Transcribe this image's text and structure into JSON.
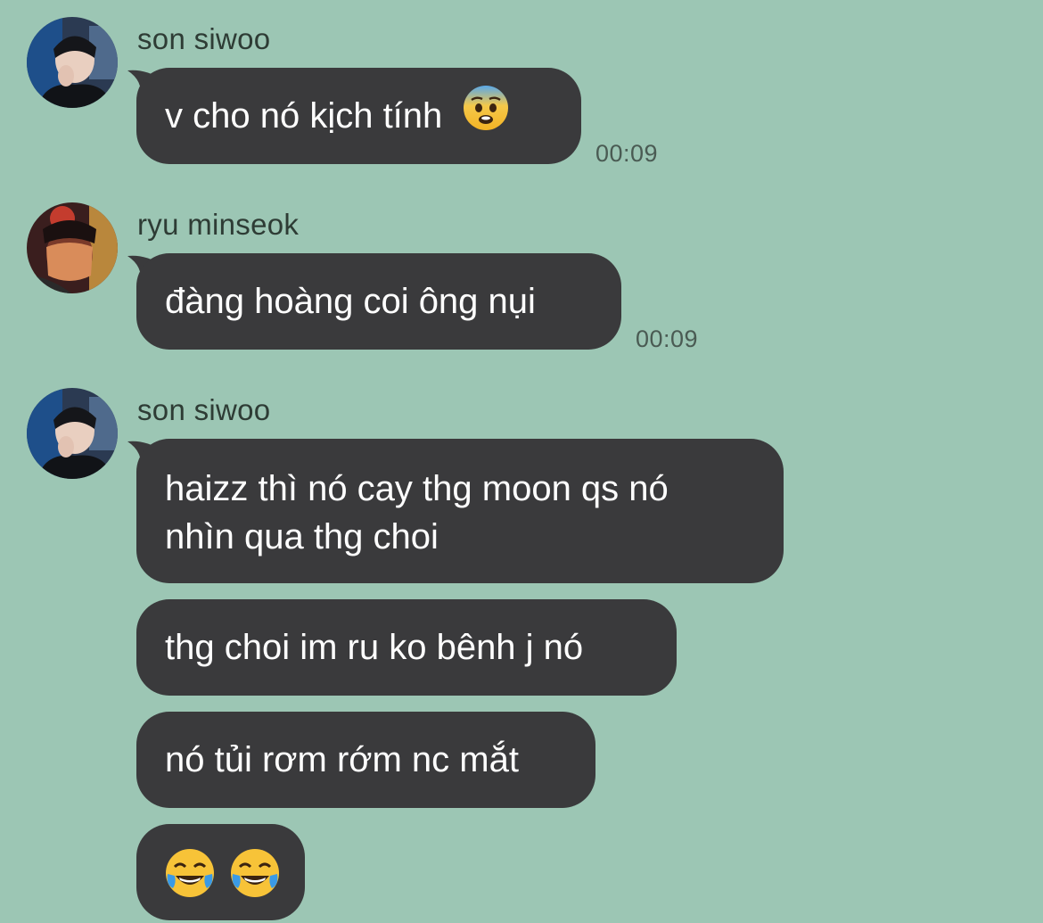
{
  "messages": [
    {
      "sender": "son siwoo",
      "avatar_icon": "user-avatar-icon",
      "bubbles": [
        {
          "text": "v cho nó kịch tính",
          "emoji": "fearful-face-emoji"
        }
      ],
      "time": "00:09"
    },
    {
      "sender": "ryu minseok",
      "avatar_icon": "user-avatar-icon",
      "bubbles": [
        {
          "text": "đàng hoàng coi ông nụi"
        }
      ],
      "time": "00:09"
    },
    {
      "sender": "son siwoo",
      "avatar_icon": "user-avatar-icon",
      "bubbles": [
        {
          "line1": "haizz thì nó cay thg moon qs nó",
          "line2": "nhìn qua thg choi"
        },
        {
          "text": "thg choi im ru ko bênh j nó"
        },
        {
          "text": "nó tủi rơm rớm nc mắt"
        },
        {
          "emoji": "face-with-tears-of-joy-emoji",
          "emoji_count": 2
        }
      ]
    }
  ],
  "colors": {
    "background": "#9cc6b4",
    "bubble": "#3a3a3c",
    "bubble_text": "#ffffff",
    "name_text": "#2e3c35",
    "time_text": "#4a5b53"
  }
}
